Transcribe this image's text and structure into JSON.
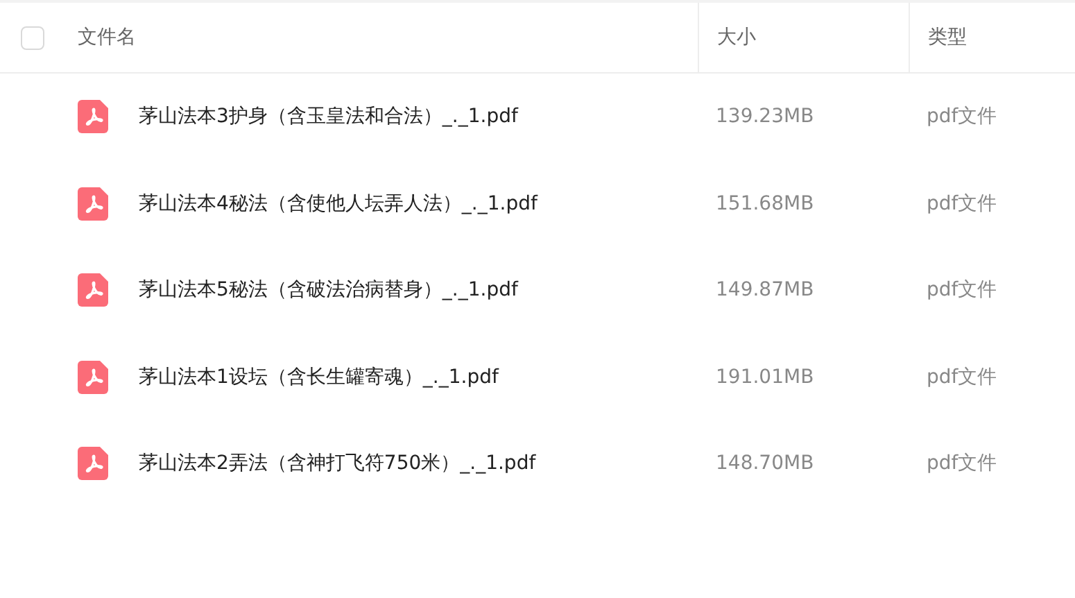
{
  "table": {
    "select_all": {
      "checked": false
    },
    "columns": [
      "文件名",
      "大小",
      "类型"
    ],
    "rows": [
      {
        "kind": "pdf",
        "name": "茅山法本3护身（含玉皇法和合法）_._1.pdf",
        "size": "139.23MB",
        "type": "pdf文件"
      },
      {
        "kind": "pdf",
        "name": "茅山法本4秘法（含使他人坛弄人法）_._1.pdf",
        "size": "151.68MB",
        "type": "pdf文件"
      },
      {
        "kind": "pdf",
        "name": "茅山法本5秘法（含破法治病替身）_._1.pdf",
        "size": "149.87MB",
        "type": "pdf文件"
      },
      {
        "kind": "pdf",
        "name": "茅山法本1设坛（含长生罐寄魂）_._1.pdf",
        "size": "191.01MB",
        "type": "pdf文件"
      },
      {
        "kind": "pdf",
        "name": "茅山法本2弄法（含神打飞符750米）_._1.pdf",
        "size": "148.70MB",
        "type": "pdf文件"
      }
    ]
  }
}
